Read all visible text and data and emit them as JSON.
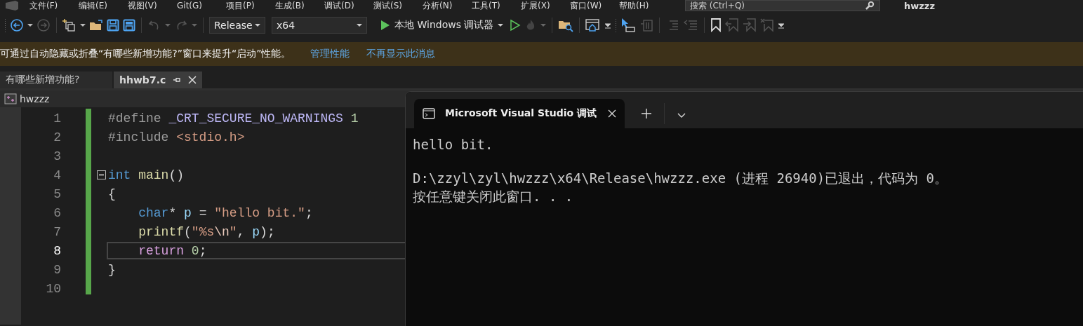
{
  "menu": [
    "文件(F)",
    "编辑(E)",
    "视图(V)",
    "Git(G)",
    "项目(P)",
    "生成(B)",
    "调试(D)",
    "测试(S)",
    "分析(N)",
    "工具(T)",
    "扩展(X)",
    "窗口(W)",
    "帮助(H)"
  ],
  "search": {
    "placeholder": "搜索 (Ctrl+Q)"
  },
  "solution_title": "hwzzz",
  "toolbar": {
    "configuration": "Release",
    "platform": "x64",
    "run_label": "本地 Windows 调试器"
  },
  "info_bar": {
    "message": "可通过自动隐藏或折叠“有哪些新增功能?”窗口来提升“启动”性能。",
    "links": [
      "管理性能",
      "不再显示此消息"
    ]
  },
  "doc_tabs": [
    {
      "label": "有哪些新增功能?",
      "selected": false
    },
    {
      "label": "hhwb7.c",
      "selected": true
    }
  ],
  "nav_bar": {
    "project": "hwzzz"
  },
  "editor": {
    "lines": [
      {
        "number": "1",
        "current": false,
        "tokens": [
          {
            "kind": "pp",
            "text": "#define "
          },
          {
            "kind": "macro",
            "text": "_CRT_SECURE_NO_WARNINGS"
          },
          {
            "kind": "number",
            "text": " 1"
          }
        ]
      },
      {
        "number": "2",
        "current": false,
        "tokens": [
          {
            "kind": "pp",
            "text": "#include "
          },
          {
            "kind": "string",
            "text": "<stdio.h>"
          }
        ]
      },
      {
        "number": "3",
        "current": false
      },
      {
        "number": "4",
        "current": false,
        "fold": true,
        "tokens": [
          {
            "kind": "keyword",
            "text": "int"
          },
          {
            "kind": "function",
            "text": " main"
          },
          {
            "kind": "plain",
            "text": "()"
          }
        ]
      },
      {
        "number": "5",
        "current": false,
        "tokens": [
          {
            "kind": "plain",
            "text": "{"
          }
        ]
      },
      {
        "number": "6",
        "current": false,
        "tokens": [
          {
            "kind": "keyword",
            "text": "    char"
          },
          {
            "kind": "plain",
            "text": "* "
          },
          {
            "kind": "variable",
            "text": "p"
          },
          {
            "kind": "plain",
            "text": " = "
          },
          {
            "kind": "string",
            "text": "\"hello bit.\""
          },
          {
            "kind": "plain",
            "text": ";"
          }
        ]
      },
      {
        "number": "7",
        "current": false,
        "tokens": [
          {
            "kind": "function",
            "text": "    printf"
          },
          {
            "kind": "plain",
            "text": "("
          },
          {
            "kind": "string",
            "text": "\"%s"
          },
          {
            "kind": "escape",
            "text": "\\n"
          },
          {
            "kind": "string",
            "text": "\""
          },
          {
            "kind": "plain",
            "text": ", "
          },
          {
            "kind": "variable",
            "text": "p"
          },
          {
            "kind": "plain",
            "text": ");"
          }
        ]
      },
      {
        "number": "8",
        "current": true,
        "tokens": [
          {
            "kind": "control",
            "text": "    return"
          },
          {
            "kind": "number",
            "text": " 0"
          },
          {
            "kind": "plain",
            "text": ";"
          }
        ]
      },
      {
        "number": "9",
        "current": false,
        "tokens": [
          {
            "kind": "plain",
            "text": "}"
          }
        ]
      },
      {
        "number": "10",
        "current": false
      }
    ]
  },
  "console": {
    "tab_title": "Microsoft Visual Studio 调试",
    "output": [
      [
        "hello bit."
      ],
      [
        "D:\\zzyl\\zyl\\hwzzz\\x64\\Release\\hwzzz.exe (进程 26940)已退出，代码为 0。",
        "按任意键关闭此窗口. . ."
      ]
    ]
  }
}
